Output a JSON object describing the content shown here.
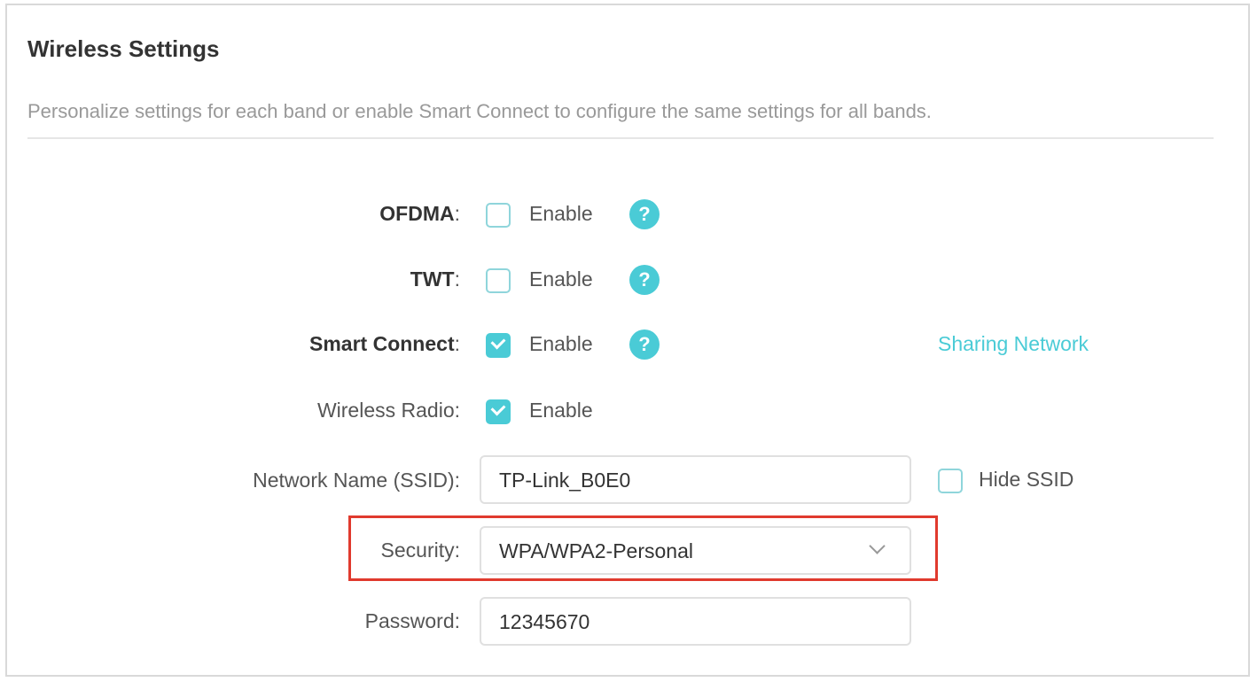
{
  "header": {
    "title": "Wireless Settings",
    "description": "Personalize settings for each band or enable Smart Connect to configure the same settings for all bands."
  },
  "rows": {
    "ofdma": {
      "label": "OFDMA",
      "colon": ":",
      "checked": false,
      "option": "Enable",
      "help": "?"
    },
    "twt": {
      "label": "TWT",
      "colon": ":",
      "checked": false,
      "option": "Enable",
      "help": "?"
    },
    "smart_connect": {
      "label": "Smart Connect",
      "colon": ":",
      "checked": true,
      "option": "Enable",
      "help": "?",
      "link": "Sharing Network"
    },
    "wireless_radio": {
      "label": "Wireless Radio:",
      "checked": true,
      "option": "Enable"
    },
    "ssid": {
      "label": "Network Name (SSID):",
      "value": "TP-Link_B0E0",
      "hide_label": "Hide SSID",
      "hide_checked": false
    },
    "security": {
      "label": "Security:",
      "value": "WPA/WPA2-Personal"
    },
    "password": {
      "label": "Password:",
      "value": "12345670"
    }
  },
  "colors": {
    "accent": "#4acbd6",
    "highlight": "#e03a2e"
  }
}
